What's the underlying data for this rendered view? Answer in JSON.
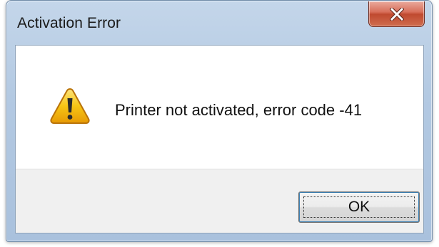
{
  "dialog": {
    "title": "Activation Error",
    "close_icon": "close-icon",
    "message": "Printer not activated, error code -41",
    "icon": "warning-icon",
    "ok_label": "OK"
  },
  "colors": {
    "close_button": "#c94f36",
    "frame": "#b3c9e2",
    "warning_yellow": "#f7c514"
  }
}
